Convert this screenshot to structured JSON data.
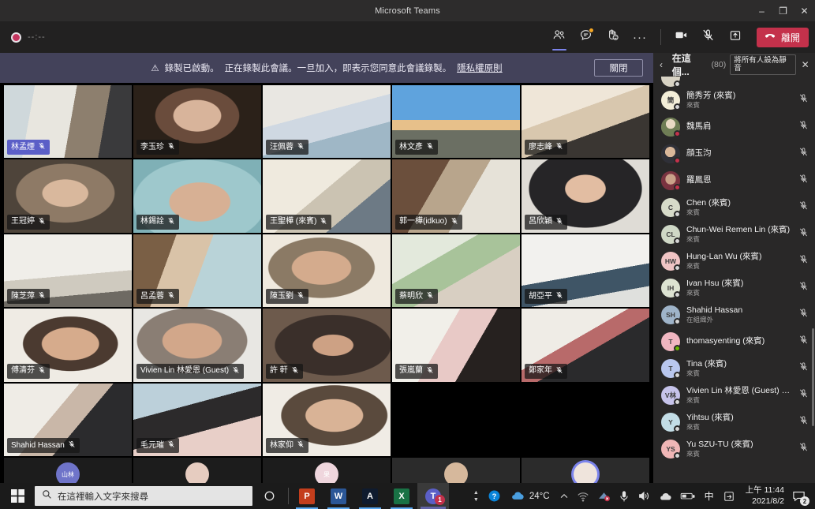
{
  "window": {
    "title": "Microsoft Teams",
    "minimize": "–",
    "maximize": "❐",
    "close": "✕"
  },
  "toolbar": {
    "recording_timer": "--:--",
    "people_label": "顯示參與者",
    "chat_label": "顯示對話",
    "reactions_label": "反應",
    "more_label": "更多選項",
    "more_glyph": "···",
    "camera_label": "關閉視訊",
    "mic_label": "取消靜音",
    "share_label": "共用內容",
    "leave_label": "離開"
  },
  "banner": {
    "warning_icon": "⚠",
    "text": "錄製已啟動。",
    "text2": "正在錄製此會議。一旦加入，即表示您同意此會議錄製。",
    "link": "隱私權原則",
    "close_label": "關閉"
  },
  "panel": {
    "back_glyph": "‹",
    "title": "在這個...",
    "count": "(80)",
    "mute_all_label": "將所有人設為靜音",
    "close_glyph": "✕",
    "participants": [
      {
        "name": "",
        "sub": "",
        "initials": "",
        "avatar_color": "#d8d3c4",
        "photo": "",
        "presence": "offline",
        "muted": true,
        "clipped": true
      },
      {
        "name": "簡秀芳 (來賓)",
        "sub": "來賓",
        "initials": "簡",
        "avatar_color": "#f3eed8",
        "photo": "",
        "presence": "offline",
        "muted": true
      },
      {
        "name": "魏馬肩",
        "sub": "",
        "initials": "",
        "avatar_color": "#7d8a62",
        "photo": "radial-gradient(circle at 50% 34%, #e8d9c3 0 30%, #6f7d55 31% 100%)",
        "presence": "away",
        "muted": true
      },
      {
        "name": "顔玉汮",
        "sub": "",
        "initials": "",
        "avatar_color": "#3b3b44",
        "photo": "radial-gradient(circle at 48% 40%, #d9b79a 0 34%, #2f3038 35% 100%)",
        "presence": "away",
        "muted": true
      },
      {
        "name": "羅鳳恩",
        "sub": "",
        "initials": "",
        "avatar_color": "#7a3340",
        "photo": "radial-gradient(circle at 50% 42%, #caa189 0 36%, #7a3340 37% 100%)",
        "presence": "away",
        "muted": true
      },
      {
        "name": "Chen (來賓)",
        "sub": "來賓",
        "initials": "C",
        "avatar_color": "#d7dbc9",
        "photo": "",
        "presence": "offline",
        "muted": true
      },
      {
        "name": "Chun-Wei Remen Lin (來賓)",
        "sub": "來賓",
        "initials": "CL",
        "avatar_color": "#cfd8c6",
        "photo": "",
        "presence": "offline",
        "muted": true
      },
      {
        "name": "Hung-Lan Wu (來賓)",
        "sub": "來賓",
        "initials": "HW",
        "avatar_color": "#f0c4c4",
        "photo": "",
        "presence": "offline",
        "muted": true
      },
      {
        "name": "Ivan Hsu (來賓)",
        "sub": "來賓",
        "initials": "IH",
        "avatar_color": "#dde3d2",
        "photo": "",
        "presence": "offline",
        "muted": true
      },
      {
        "name": "Shahid Hassan",
        "sub": "在組織外",
        "initials": "SH",
        "avatar_color": "#9fb4c9",
        "photo": "",
        "presence": "offline",
        "muted": true
      },
      {
        "name": "thomasyenting (來賓)",
        "sub": "",
        "initials": "T",
        "avatar_color": "#f0b6c0",
        "photo": "",
        "presence": "online",
        "muted": true
      },
      {
        "name": "Tina (來賓)",
        "sub": "來賓",
        "initials": "T",
        "avatar_color": "#b9c7ee",
        "photo": "",
        "presence": "offline",
        "muted": true
      },
      {
        "name": "Vivien Lin 林愛恩 (Guest) (來賓)",
        "sub": "來賓",
        "initials": "V林",
        "avatar_color": "#c6c3ea",
        "photo": "",
        "presence": "offline",
        "muted": true
      },
      {
        "name": "Yihtsu (來賓)",
        "sub": "來賓",
        "initials": "Y",
        "avatar_color": "#c3dde6",
        "photo": "",
        "presence": "offline",
        "muted": true
      },
      {
        "name": "Yu SZU-TU (來賓)",
        "sub": "來賓",
        "initials": "YS",
        "avatar_color": "#f0b6b6",
        "photo": "",
        "presence": "offline",
        "muted": true
      }
    ]
  },
  "stage": {
    "mic_off_glyph": "⌀",
    "tiles": [
      {
        "name": "林孟煙",
        "muted": true,
        "speaking": true,
        "bg": "linear-gradient(100deg,#cfd8db 0 22%,#e8e6df 22% 52%,#8d7f6e 52% 76%,#3a3a3c 76% 100%)"
      },
      {
        "name": "李玉珍",
        "muted": true,
        "speaking": false,
        "bg": "radial-gradient(ellipse at 50% 42%, #d8b49b 0 26%, #6a4c3c 27% 46%, #2b2119 47% 100%)"
      },
      {
        "name": "汪佩蓉",
        "muted": true,
        "speaking": false,
        "bg": "linear-gradient(165deg,#e9e7e2 0 40%,#cfd8e2 40% 66%,#9fb7c6 66% 100%)"
      },
      {
        "name": "林文彥",
        "muted": true,
        "speaking": false,
        "bg": "linear-gradient(180deg,#5fa3dd 0 48%,#e7c08a 48% 62%,#6b6f63 62% 100%)"
      },
      {
        "name": "廖志峰",
        "muted": true,
        "speaking": false,
        "bg": "linear-gradient(160deg,#efe6d8 0 38%,#d8c7ae 38% 62%,#3a3632 62% 100%)"
      },
      {
        "name": "王冠婷",
        "muted": true,
        "speaking": false,
        "bg": "radial-gradient(ellipse at 48% 46%, #d9b89d 0 24%, #8e7a66 25% 52%, #4e443a 53% 100%)"
      },
      {
        "name": "林錫詮",
        "muted": true,
        "speaking": false,
        "bg": "radial-gradient(ellipse at 52% 58%, #d7b094 0 32%, #9ec8cc 33% 70%, #7fb0b6 71% 100%)"
      },
      {
        "name": "王聖樺 (來賓)",
        "muted": true,
        "speaking": false,
        "bg": "linear-gradient(140deg,#efeade 0 46%,#cbc3b2 46% 70%,#6d7a85 70% 100%)"
      },
      {
        "name": "郭一樺(idkuo)",
        "muted": true,
        "speaking": false,
        "bg": "linear-gradient(120deg,#6b4f3c 0 34%,#b8a58c 34% 58%,#e6e2d8 58% 100%)"
      },
      {
        "name": "呂欣穎",
        "muted": true,
        "speaking": false,
        "bg": "radial-gradient(ellipse at 50% 40%, #e2bda2 0 22%, #262527 23% 62%, #dfdcd6 63% 100%)"
      },
      {
        "name": "陳芝萍",
        "muted": true,
        "speaking": false,
        "bg": "linear-gradient(175deg,#f0eee9 0 56%,#cfcabf 56% 80%,#6e6a63 80% 100%)"
      },
      {
        "name": "呂孟蓉",
        "muted": true,
        "speaking": false,
        "bg": "linear-gradient(110deg,#7a5f45 0 28%,#d9c3a8 28% 52%,#b9d3d8 52% 100%)"
      },
      {
        "name": "陳玉劉",
        "muted": true,
        "speaking": false,
        "bg": "radial-gradient(ellipse at 46% 46%, #d4ab8d 0 30%, #8b7a65 31% 54%, #efe9de 55% 100%)"
      },
      {
        "name": "蔡明欣",
        "muted": true,
        "speaking": false,
        "bg": "linear-gradient(150deg,#e3e9dc 0 34%,#a8c39a 34% 58%,#d8cfc2 58% 100%)"
      },
      {
        "name": "胡亞平",
        "muted": true,
        "speaking": false,
        "bg": "linear-gradient(170deg,#f2f1ee 0 54%,#3f5566 54% 78%,#dfe0dd 78% 100%)"
      },
      {
        "name": "傅清芬",
        "muted": true,
        "speaking": false,
        "bg": "radial-gradient(ellipse at 52% 48%, #d6ab8c 0 30%, #4b3a30 31% 50%, #efebe4 51% 100%)"
      },
      {
        "name": "Vivien Lin 林愛恩 (Guest)",
        "muted": true,
        "speaking": false,
        "bg": "radial-gradient(ellipse at 46% 44%, #d2a78a 0 30%, #8a7e74 31% 56%, #e8e7e3 57% 100%)"
      },
      {
        "name": "許 軒",
        "muted": true,
        "speaking": false,
        "bg": "radial-gradient(ellipse at 55% 50%, #cda184 0 20%, #3a2f2a 21% 58%, #6d5a4c 59% 100%)"
      },
      {
        "name": "張嵐蘭",
        "muted": true,
        "speaking": false,
        "bg": "linear-gradient(120deg,#f1efe9 0 40%,#e8c9c6 40% 62%,#26211f 62% 100%)"
      },
      {
        "name": "鄭家年",
        "muted": true,
        "speaking": false,
        "bg": "linear-gradient(150deg,#efece6 0 42%,#b86a6a 42% 56%,#2a2a2c 56% 100%)"
      },
      {
        "name": "Shahid Hassan",
        "muted": true,
        "speaking": false,
        "bg": "linear-gradient(130deg,#efece6 0 40%,#c9b7a8 40% 58%,#2b2b2d 58% 100%)"
      },
      {
        "name": "毛元璀",
        "muted": true,
        "speaking": false,
        "bg": "linear-gradient(165deg,#bcd0da 0 34%,#2c2a2b 34% 62%,#e8cfc8 62% 100%)"
      },
      {
        "name": "林家仰",
        "muted": true,
        "speaking": false,
        "bg": "radial-gradient(ellipse at 56% 44%, #d9b396 0 28%, #5a4a3d 29% 52%, #f0ece5 53% 100%)"
      }
    ],
    "overflow": [
      {
        "initials": "山林",
        "color": "#6f74c9",
        "speaking": false,
        "dark": true
      },
      {
        "initials": "",
        "color": "#e6ccc0",
        "speaking": false,
        "dark": true
      },
      {
        "initials": "果",
        "color": "#efd6dd",
        "speaking": false,
        "dark": true
      },
      {
        "initials": "",
        "color": "#d6b89c",
        "speaking": false,
        "dark": false
      },
      {
        "initials": "",
        "color": "#efe4dc",
        "speaking": true,
        "dark": false
      },
      {
        "initials": "",
        "color": "#cdbfb2",
        "speaking": false,
        "dark": false
      },
      {
        "initials": "",
        "color": "#e7d3c4",
        "speaking": false,
        "dark": false
      },
      {
        "initials": "",
        "color": "#bfd9ef",
        "speaking": false,
        "dark": false
      }
    ]
  },
  "taskbar": {
    "search_placeholder": "在這裡輸入文字來搜尋",
    "cortana_label": "Cortana",
    "apps": [
      {
        "name": "powerpoint",
        "glyph": "P",
        "color": "#c43e1c",
        "open": true,
        "badge": ""
      },
      {
        "name": "word",
        "glyph": "W",
        "color": "#2b5797",
        "open": true,
        "badge": ""
      },
      {
        "name": "acrobat",
        "glyph": "A",
        "color": "#0f1b2e",
        "open": true,
        "badge": ""
      },
      {
        "name": "excel",
        "glyph": "X",
        "color": "#197245",
        "open": true,
        "badge": ""
      },
      {
        "name": "teams",
        "glyph": "T",
        "color": "#5b5fc7",
        "open": true,
        "badge": "1"
      }
    ],
    "temperature": "24°C",
    "ime": "中",
    "time": "上午 11:44",
    "date": "2021/8/2",
    "notification_count": "2"
  }
}
